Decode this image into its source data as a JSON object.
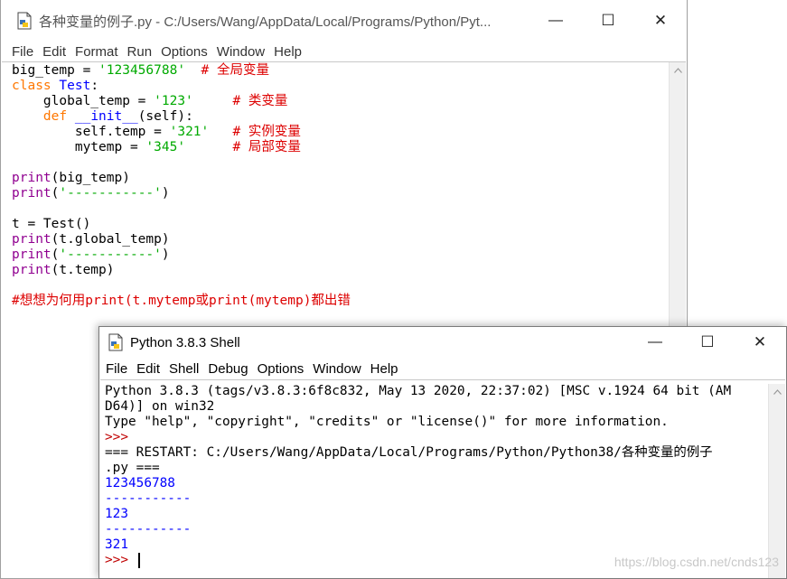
{
  "editor": {
    "title": "各种变量的例子.py - C:/Users/Wang/AppData/Local/Programs/Python/Pyt...",
    "menu": [
      "File",
      "Edit",
      "Format",
      "Run",
      "Options",
      "Window",
      "Help"
    ],
    "code": [
      [
        [
          "",
          "big_temp = "
        ],
        [
          "st",
          "'123456788'"
        ],
        [
          "",
          "  "
        ],
        [
          "cm",
          "# 全局变量"
        ]
      ],
      [
        [
          "kw",
          "class"
        ],
        [
          "",
          " "
        ],
        [
          "df",
          "Test"
        ],
        [
          "",
          ":"
        ]
      ],
      [
        [
          "",
          "    global_temp = "
        ],
        [
          "st",
          "'123'"
        ],
        [
          "",
          "     "
        ],
        [
          "cm",
          "# 类变量"
        ]
      ],
      [
        [
          "",
          "    "
        ],
        [
          "kw",
          "def"
        ],
        [
          "",
          " "
        ],
        [
          "df",
          "__init__"
        ],
        [
          "",
          "(self):"
        ]
      ],
      [
        [
          "",
          "        self.temp = "
        ],
        [
          "st",
          "'321'"
        ],
        [
          "",
          "   "
        ],
        [
          "cm",
          "# 实例变量"
        ]
      ],
      [
        [
          "",
          "        mytemp = "
        ],
        [
          "st",
          "'345'"
        ],
        [
          "",
          "      "
        ],
        [
          "cm",
          "# 局部变量"
        ]
      ],
      [],
      [
        [
          "bi",
          "print"
        ],
        [
          "",
          "(big_temp)"
        ]
      ],
      [
        [
          "bi",
          "print"
        ],
        [
          "",
          "("
        ],
        [
          "st",
          "'-----------'"
        ],
        [
          "",
          ")"
        ]
      ],
      [],
      [
        [
          "",
          "t = Test()"
        ]
      ],
      [
        [
          "bi",
          "print"
        ],
        [
          "",
          "(t.global_temp)"
        ]
      ],
      [
        [
          "bi",
          "print"
        ],
        [
          "",
          "("
        ],
        [
          "st",
          "'-----------'"
        ],
        [
          "",
          ")"
        ]
      ],
      [
        [
          "bi",
          "print"
        ],
        [
          "",
          "(t.temp)"
        ]
      ],
      [],
      [
        [
          "cm",
          "#想想为何用print(t.mytemp或print(mytemp)都出错"
        ]
      ]
    ]
  },
  "shell": {
    "title": "Python 3.8.3 Shell",
    "menu": [
      "File",
      "Edit",
      "Shell",
      "Debug",
      "Options",
      "Window",
      "Help"
    ],
    "lines": [
      [
        [
          "",
          "Python 3.8.3 (tags/v3.8.3:6f8c832, May 13 2020, 22:37:02) [MSC v.1924 64 bit (AM"
        ]
      ],
      [
        [
          "",
          "D64)] on win32"
        ]
      ],
      [
        [
          "",
          "Type \"help\", \"copyright\", \"credits\" or \"license()\" for more information."
        ]
      ],
      [
        [
          "prompt",
          ">>>"
        ]
      ],
      [
        [
          "",
          "=== RESTART: C:/Users/Wang/AppData/Local/Programs/Python/Python38/各种变量的例子"
        ]
      ],
      [
        [
          "",
          ".py ==="
        ]
      ],
      [
        [
          "out",
          "123456788"
        ]
      ],
      [
        [
          "out",
          "-----------"
        ]
      ],
      [
        [
          "out",
          "123"
        ]
      ],
      [
        [
          "out",
          "-----------"
        ]
      ],
      [
        [
          "out",
          "321"
        ]
      ],
      [
        [
          "prompt",
          ">>> "
        ]
      ]
    ]
  },
  "window_controls": {
    "minimize": "—",
    "maximize": "☐",
    "close": "✕"
  },
  "watermark": "https://blog.csdn.net/cnds123",
  "colors": {
    "keyword": "#ff7700",
    "builtin": "#900090",
    "string": "#00aa00",
    "comment": "#dd0000",
    "definition": "#0000ff",
    "stdout": "#0000ff",
    "prompt": "#c00000"
  }
}
